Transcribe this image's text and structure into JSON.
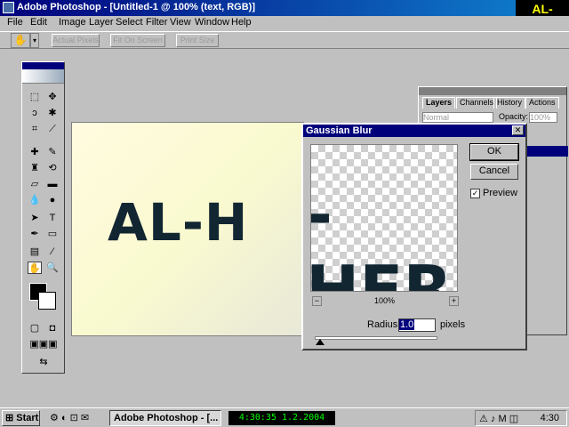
{
  "window": {
    "title": "Adobe Photoshop - [Untitled-1 @ 100% (text, RGB)]",
    "badge": "AL-HERA"
  },
  "menu": [
    "File",
    "Edit",
    "Image",
    "Layer",
    "Select",
    "Filter",
    "View",
    "Window",
    "Help"
  ],
  "options_bar": {
    "buttons": [
      "Actual Pixels",
      "Fit On Screen",
      "Print Size"
    ]
  },
  "canvas": {
    "text": "AL-H"
  },
  "layers_palette": {
    "tabs": [
      "Layers",
      "Channels",
      "History",
      "Actions"
    ],
    "blend_mode": "Normal",
    "opacity_label": "Opacity:",
    "opacity_value": "100%"
  },
  "dialog": {
    "title": "Gaussian Blur",
    "preview_text": "-HER",
    "zoom": "100%",
    "ok": "OK",
    "cancel": "Cancel",
    "preview_label": "Preview",
    "preview_checked": true,
    "radius_label": "Radius:",
    "radius_value": "1.0",
    "units": "pixels"
  },
  "taskbar": {
    "start": "Start",
    "task": "Adobe Photoshop - [...",
    "clock_display": "4:30:35  1.2.2004",
    "time": "4:30"
  }
}
